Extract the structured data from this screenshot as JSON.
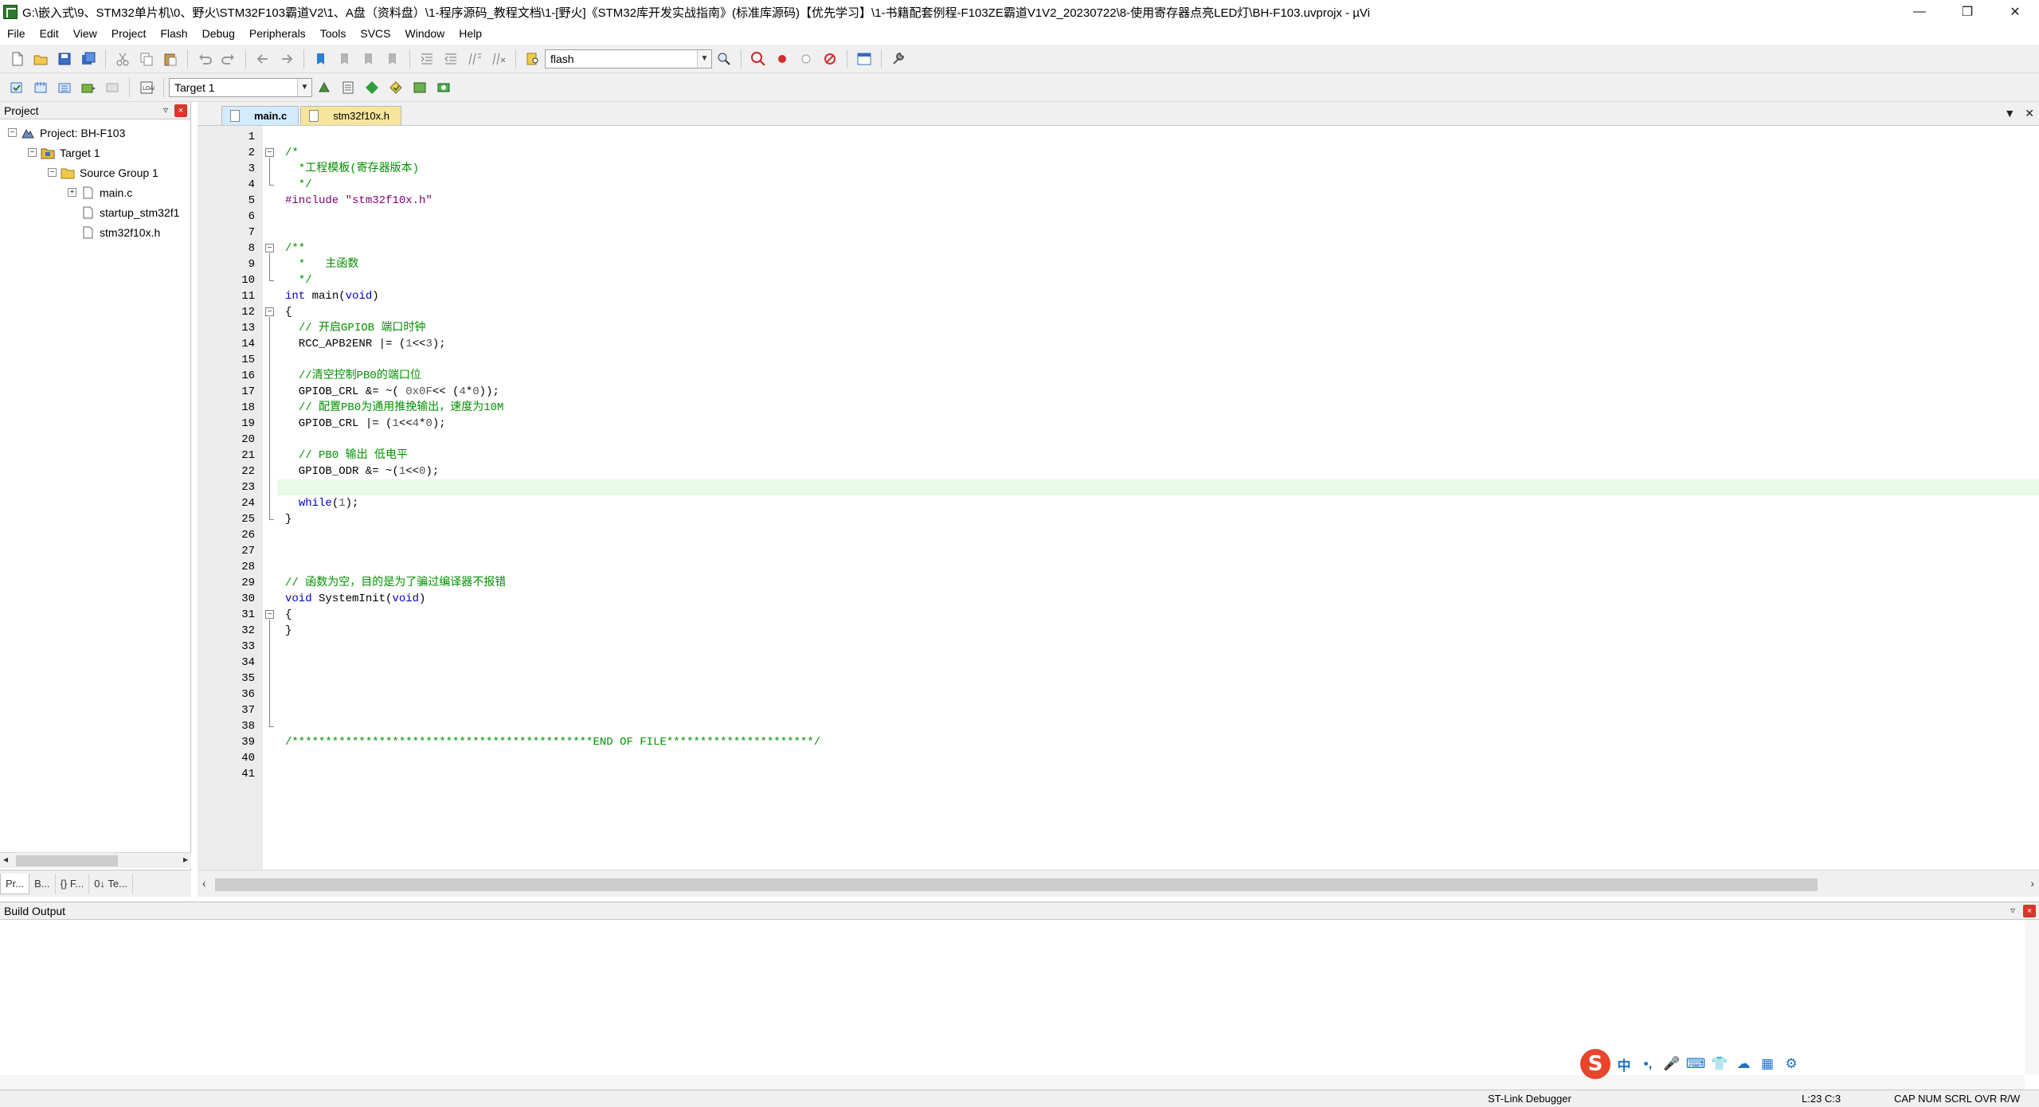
{
  "window": {
    "title": "G:\\嵌入式\\9、STM32单片机\\0、野火\\STM32F103霸道V2\\1、A盘（资料盘）\\1-程序源码_教程文档\\1-[野火]《STM32库开发实战指南》(标准库源码)【优先学习】\\1-书籍配套例程-F103ZE霸道V1V2_20230722\\8-使用寄存器点亮LED灯\\BH-F103.uvprojx - µVi",
    "minimize": "—",
    "restore": "❐",
    "close": "✕"
  },
  "menu": [
    "File",
    "Edit",
    "View",
    "Project",
    "Flash",
    "Debug",
    "Peripherals",
    "Tools",
    "SVCS",
    "Window",
    "Help"
  ],
  "toolbar1": {
    "find_combo_value": "flash",
    "icons": [
      "new-file-icon",
      "open-file-icon",
      "save-icon",
      "save-all-icon",
      "cut-icon",
      "copy-icon",
      "paste-icon",
      "undo-icon",
      "redo-icon",
      "nav-back-icon",
      "nav-forward-icon",
      "bookmark-icon",
      "prev-bookmark-icon",
      "next-bookmark-icon",
      "clear-bookmarks-icon",
      "indent-icon",
      "unindent-icon",
      "comment-icon",
      "uncomment-icon",
      "find-in-files-icon",
      "find-icon",
      "debug-session-icon",
      "breakpoint-icon",
      "disable-breakpoint-icon",
      "kill-breakpoints-icon",
      "windows-icon",
      "configure-icon"
    ]
  },
  "toolbar2": {
    "target_combo_value": "Target 1",
    "icons": [
      "translate-icon",
      "build-icon",
      "rebuild-icon",
      "batch-build-icon",
      "stop-build-icon",
      "download-icon",
      "target-options-icon",
      "manage-components-icon",
      "project-items-icon",
      "pack-installer-icon",
      "select-packs-icon",
      "run-environment-icon"
    ]
  },
  "project_panel": {
    "title": "Project",
    "pin": "▿",
    "close": "×",
    "tree": [
      {
        "label": "Project: BH-F103",
        "level": 0,
        "toggle": "−",
        "icon": "project-icon"
      },
      {
        "label": "Target 1",
        "level": 1,
        "toggle": "−",
        "icon": "target-folder-icon"
      },
      {
        "label": "Source Group 1",
        "level": 2,
        "toggle": "−",
        "icon": "folder-icon"
      },
      {
        "label": "main.c",
        "level": 3,
        "toggle": "+",
        "icon": "c-file-icon"
      },
      {
        "label": "startup_stm32f1",
        "level": 4,
        "toggle": "",
        "icon": "asm-file-icon"
      },
      {
        "label": "stm32f10x.h",
        "level": 4,
        "toggle": "",
        "icon": "header-file-icon"
      }
    ],
    "tabs": [
      "Pr...",
      "B...",
      "{} F...",
      "0↓ Te..."
    ]
  },
  "editor": {
    "tabs": [
      {
        "label": "main.c",
        "active": true
      },
      {
        "label": "stm32f10x.h",
        "active": false
      }
    ],
    "tab_menu": "▼",
    "tab_close": "✕",
    "current_line": 23,
    "lines": [
      [],
      [
        [
          "cm",
          "/*"
        ]
      ],
      [
        [
          "cm",
          "  *工程模板(寄存器版本)"
        ]
      ],
      [
        [
          "cm",
          "  */"
        ]
      ],
      [
        [
          "pp",
          "#include "
        ],
        [
          "st",
          "\"stm32f10x.h\""
        ]
      ],
      [],
      [],
      [
        [
          "cm",
          "/**"
        ]
      ],
      [
        [
          "cm",
          "  *   主函数"
        ]
      ],
      [
        [
          "cm",
          "  */"
        ]
      ],
      [
        [
          "kw",
          "int"
        ],
        [
          "tx",
          " main("
        ],
        [
          "kw",
          "void"
        ],
        [
          "tx",
          ")"
        ]
      ],
      [
        [
          "tx",
          "{"
        ]
      ],
      [
        [
          "tx",
          "  "
        ],
        [
          "cm",
          "// 开启GPIOB 端口时钟"
        ]
      ],
      [
        [
          "tx",
          "  RCC_APB2ENR |= ("
        ],
        [
          "nm",
          "1"
        ],
        [
          "tx",
          "<<"
        ],
        [
          "nm",
          "3"
        ],
        [
          "tx",
          ");"
        ]
      ],
      [],
      [
        [
          "tx",
          "  "
        ],
        [
          "cm",
          "//清空控制PB0的端口位"
        ]
      ],
      [
        [
          "tx",
          "  GPIOB_CRL &= ~( "
        ],
        [
          "nm",
          "0x0F"
        ],
        [
          "tx",
          "<< ("
        ],
        [
          "nm",
          "4"
        ],
        [
          "tx",
          "*"
        ],
        [
          "nm",
          "0"
        ],
        [
          "tx",
          "));"
        ]
      ],
      [
        [
          "tx",
          "  "
        ],
        [
          "cm",
          "// 配置PB0为通用推挽输出，速度为10M"
        ]
      ],
      [
        [
          "tx",
          "  GPIOB_CRL |= ("
        ],
        [
          "nm",
          "1"
        ],
        [
          "tx",
          "<<"
        ],
        [
          "nm",
          "4"
        ],
        [
          "tx",
          "*"
        ],
        [
          "nm",
          "0"
        ],
        [
          "tx",
          ");"
        ]
      ],
      [],
      [
        [
          "tx",
          "  "
        ],
        [
          "cm",
          "// PB0 输出 低电平"
        ]
      ],
      [
        [
          "tx",
          "  GPIOB_ODR &= ~("
        ],
        [
          "nm",
          "1"
        ],
        [
          "tx",
          "<<"
        ],
        [
          "nm",
          "0"
        ],
        [
          "tx",
          ");"
        ]
      ],
      [],
      [
        [
          "tx",
          "  "
        ],
        [
          "kw",
          "while"
        ],
        [
          "tx",
          "("
        ],
        [
          "nm",
          "1"
        ],
        [
          "tx",
          ");"
        ]
      ],
      [
        [
          "tx",
          "}"
        ]
      ],
      [],
      [],
      [],
      [
        [
          "cm",
          "// 函数为空，目的是为了骗过编译器不报错"
        ]
      ],
      [
        [
          "kw",
          "void"
        ],
        [
          "tx",
          " SystemInit("
        ],
        [
          "kw",
          "void"
        ],
        [
          "tx",
          ")"
        ]
      ],
      [
        [
          "tx",
          "{"
        ]
      ],
      [
        [
          "tx",
          "}"
        ]
      ],
      [],
      [],
      [],
      [],
      [],
      [],
      [
        [
          "cm",
          "/*********************************************END OF FILE**********************/"
        ]
      ],
      [],
      []
    ]
  },
  "build_output": {
    "title": "Build Output",
    "pin": "▿",
    "close": "×"
  },
  "status_bar": {
    "debugger": "ST-Link Debugger",
    "position": "L:23 C:3",
    "flags": "CAP  NUM  SCRL  OVR  R/W"
  },
  "ime": {
    "logo": "S",
    "items": [
      "中",
      "•,",
      "🎤",
      "⌨",
      "👕",
      "☁",
      "▦",
      "⚙"
    ]
  },
  "colors": {
    "comment": "#009100",
    "keyword": "#0000c8",
    "string": "#7a0078",
    "current_line_bg": "#e8fbe8",
    "active_tab_bg": "#d3ebff",
    "inactive_tab_bg": "#f6e59b"
  }
}
